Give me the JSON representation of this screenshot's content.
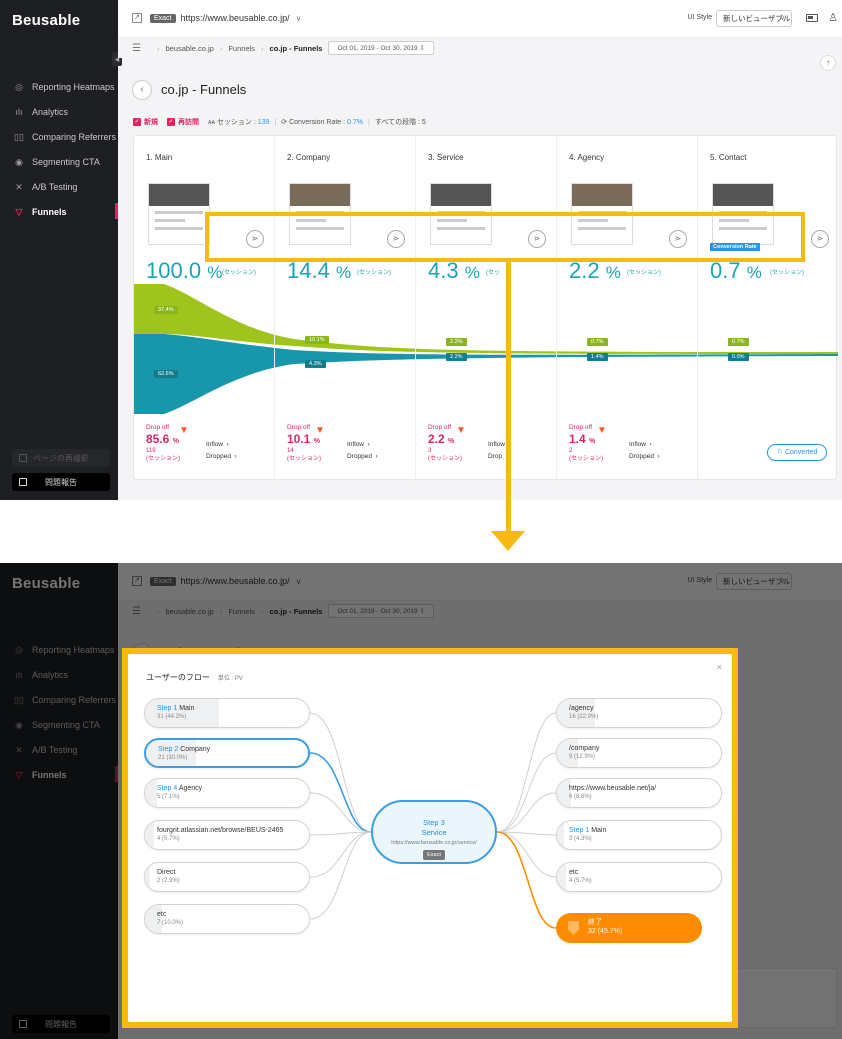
{
  "app": {
    "brand": "Beusable",
    "url_badge": "Exact",
    "url": "https://www.beusable.co.jp/",
    "ui_style_label": "UI Style",
    "ui_style_value": "新しいビューザブル"
  },
  "sidebar": {
    "items": [
      {
        "label": "Reporting Heatmaps",
        "icon": "heatmap-icon"
      },
      {
        "label": "Analytics",
        "icon": "bar-chart-icon"
      },
      {
        "label": "Comparing Referrers",
        "icon": "compare-icon"
      },
      {
        "label": "Segmenting CTA",
        "icon": "target-icon"
      },
      {
        "label": "A/B Testing",
        "icon": "ab-test-icon"
      },
      {
        "label": "Funnels",
        "icon": "funnel-icon",
        "active": true
      }
    ],
    "recapture_label": "ページの再撮影",
    "report_label": "問題報告"
  },
  "breadcrumb": {
    "items": [
      "beusable.co.jp",
      "Funnels",
      "co.jp - Funnels"
    ],
    "date_range": "Oct 01, 2019 - Oct 30, 2019"
  },
  "page": {
    "title": "co.jp - Funnels",
    "filter_new": "新規",
    "filter_returning": "再訪問",
    "sessions_label": "セッション :",
    "sessions_value": "139",
    "conv_label": "Conversion Rate :",
    "conv_value": "0.7%",
    "all_steps": "すべての段階 : 5"
  },
  "steps": [
    {
      "name": "1. Main",
      "pct": "100.0",
      "pct_unit": "%",
      "sess": "(セッション)",
      "drop_label": "Drop off",
      "drop_pct": "85.6",
      "drop_cnt": "119",
      "drop_sess": "(セッション)",
      "inflow": "Inflow",
      "dropped": "Dropped"
    },
    {
      "name": "2. Company",
      "pct": "14.4",
      "pct_unit": "%",
      "sess": "(セッション)",
      "drop_label": "Drop off",
      "drop_pct": "10.1",
      "drop_cnt": "14",
      "drop_sess": "(セッション)",
      "inflow": "Inflow",
      "dropped": "Dropped"
    },
    {
      "name": "3. Service",
      "pct": "4.3",
      "pct_unit": "%",
      "sess": "(セッ",
      "drop_label": "Drop off",
      "drop_pct": "2.2",
      "drop_cnt": "3",
      "drop_sess": "(セッション)",
      "inflow": "Inflow",
      "dropped": "Drop"
    },
    {
      "name": "4. Agency",
      "pct": "2.2",
      "pct_unit": "%",
      "sess": "(セッション)",
      "drop_label": "Drop off",
      "drop_pct": "1.4",
      "drop_cnt": "2",
      "drop_sess": "(セッション)",
      "inflow": "Inflow",
      "dropped": "Dropped"
    },
    {
      "name": "5. Contact",
      "pct": "0.7",
      "pct_unit": "%",
      "sess": "(セッション)",
      "conversion_tag": "Conversion Rate",
      "converted_label": "Converted"
    }
  ],
  "flow_tags": {
    "green": [
      "37.4%",
      "10.1%",
      "2.2%",
      "0.7%",
      "0.7%"
    ],
    "blue": [
      "62.6%",
      "4.3%",
      "2.2%",
      "1.4%",
      "0.0%"
    ]
  },
  "modal": {
    "title": "ユーザーのフロー",
    "unit": "単位 : PV",
    "close": "×",
    "inbound": [
      {
        "step": "Step 1",
        "name": "Main",
        "sub": "31 (44.3%)",
        "share": 0.443
      },
      {
        "step": "Step 2",
        "name": "Company",
        "sub": "21 (30.0%)",
        "share": 0.3,
        "selected": true
      },
      {
        "step": "Step 4",
        "name": "Agency",
        "sub": "5 (7.1%)",
        "share": 0.071
      },
      {
        "step": "",
        "name": "fourgrit.atlassian.net/browse/BEUS-2465",
        "sub": "4 (5.7%)",
        "share": 0.057
      },
      {
        "step": "",
        "name": "Direct",
        "sub": "2 (2.9%)",
        "share": 0.029
      },
      {
        "step": "",
        "name": "etc",
        "sub": "7 (10.0%)",
        "share": 0.1
      }
    ],
    "center": {
      "step": "Step 3",
      "name": "Service",
      "url": "https://www.beusable.co.jp/service/",
      "badge": "Exact"
    },
    "outbound": [
      {
        "step": "",
        "name": "/agency",
        "sub": "16 (22.9%)",
        "share": 0.229
      },
      {
        "step": "",
        "name": "/company",
        "sub": "9 (12.9%)",
        "share": 0.129
      },
      {
        "step": "",
        "name": "https://www.beusable.net/ja/",
        "sub": "6 (8.6%)",
        "share": 0.086
      },
      {
        "step": "Step 1",
        "name": "Main",
        "sub": "3 (4.3%)",
        "share": 0.043
      },
      {
        "step": "",
        "name": "etc",
        "sub": "4 (5.7%)",
        "share": 0.057
      }
    ],
    "exit": {
      "label": "終了",
      "sub": "32 (45.7%)"
    }
  },
  "colors": {
    "accent_pink": "#e0245e",
    "teal": "#1aa3b5",
    "green": "#8ab61c",
    "blue": "#137d8c",
    "highlight": "#f6ba12",
    "exit_orange": "#ff8c00",
    "link_blue": "#2196f3"
  }
}
